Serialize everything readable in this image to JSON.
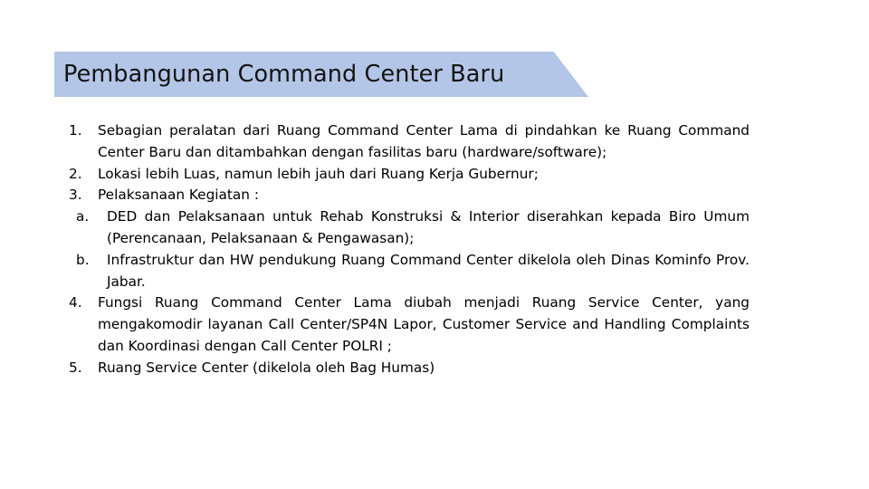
{
  "slide": {
    "title": "Pembangunan Command Center Baru",
    "banner_color": "#b3c6e7",
    "background_color": "#ffffff",
    "text_color": "#000000",
    "items": [
      {
        "marker": "1.",
        "text": "Sebagian peralatan dari Ruang Command Center Lama di pindahkan ke Ruang Command Center Baru dan ditambahkan dengan fasilitas baru (hardware/software);"
      },
      {
        "marker": "2.",
        "text": "Lokasi lebih Luas, namun lebih jauh dari Ruang Kerja Gubernur;"
      },
      {
        "marker": "3.",
        "text": "Pelaksanaan Kegiatan :",
        "subitems": [
          {
            "marker": "a.",
            "text": "DED dan Pelaksanaan untuk Rehab Konstruksi & Interior diserahkan kepada Biro Umum (Perencanaan, Pelaksanaan & Pengawasan);"
          },
          {
            "marker": "b.",
            "text": "Infrastruktur dan HW pendukung Ruang Command Center dikelola oleh Dinas Kominfo Prov. Jabar."
          }
        ]
      },
      {
        "marker": "4.",
        "text": "Fungsi Ruang Command Center Lama diubah menjadi Ruang Service Center, yang mengakomodir layanan Call Center/SP4N Lapor, Customer Service and Handling Complaints dan Koordinasi dengan Call Center POLRI ;"
      },
      {
        "marker": "5.",
        "text": "Ruang Service Center (dikelola oleh Bag Humas)"
      }
    ]
  }
}
